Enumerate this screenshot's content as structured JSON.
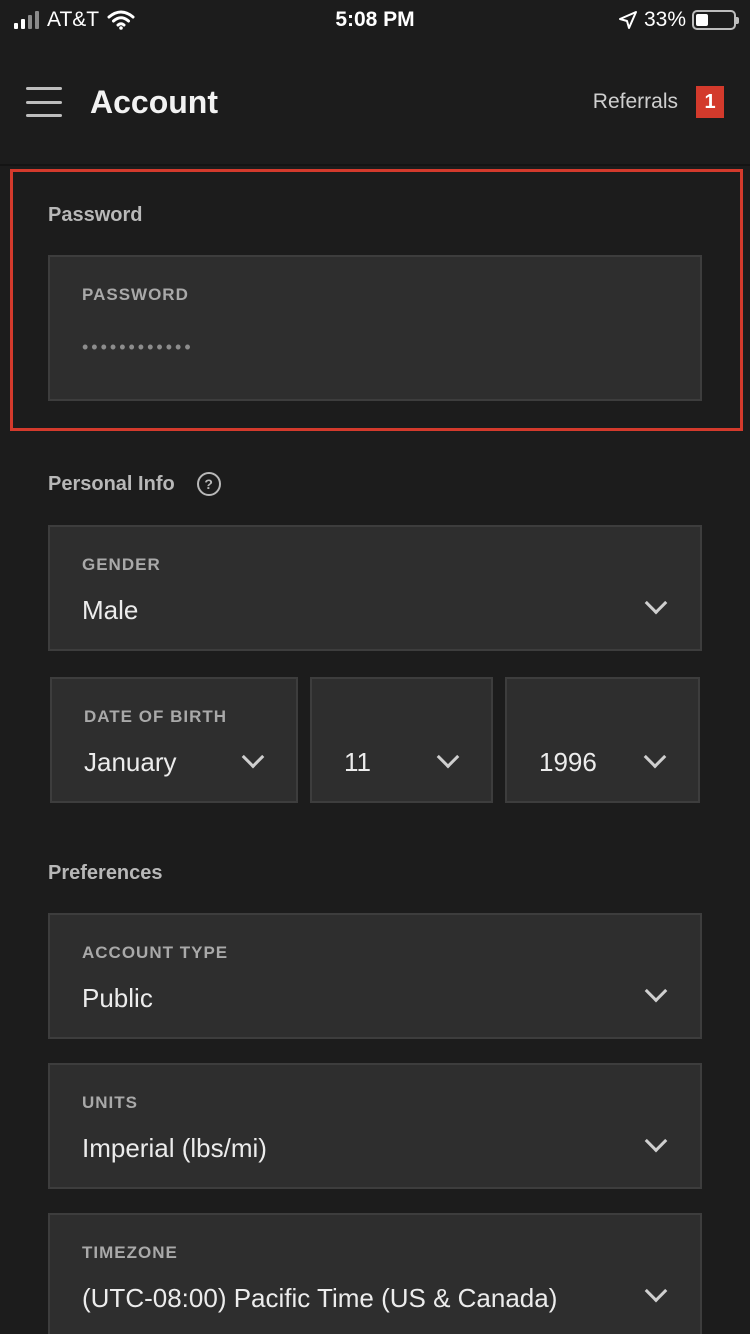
{
  "status_bar": {
    "carrier": "AT&T",
    "time": "5:08 PM",
    "battery": "33%",
    "battery_level": 0.33
  },
  "header": {
    "title": "Account",
    "referrals_label": "Referrals",
    "referrals_count": "1"
  },
  "password_section": {
    "heading": "Password",
    "field_label": "PASSWORD",
    "masked_value": "••••••••••••"
  },
  "personal_info": {
    "heading": "Personal Info",
    "help_glyph": "?",
    "gender": {
      "label": "GENDER",
      "value": "Male"
    },
    "date_of_birth": {
      "label": "DATE OF BIRTH",
      "month": "January",
      "day": "11",
      "year": "1996"
    }
  },
  "preferences": {
    "heading": "Preferences",
    "account_type": {
      "label": "ACCOUNT TYPE",
      "value": "Public"
    },
    "units": {
      "label": "UNITS",
      "value": "Imperial (lbs/mi)"
    },
    "timezone": {
      "label": "TIMEZONE",
      "value": "(UTC-08:00) Pacific Time (US & Canada)"
    }
  },
  "colors": {
    "background": "#1c1c1c",
    "field_background": "#2e2e2e",
    "accent_red": "#d33a2c"
  }
}
